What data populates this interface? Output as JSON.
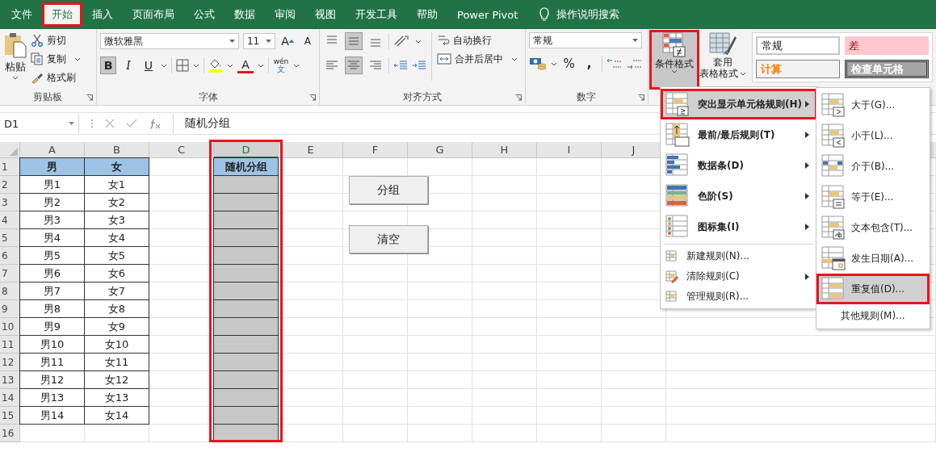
{
  "ribbon_tabs": [
    {
      "label": "文件",
      "selected": false,
      "highlighted": false
    },
    {
      "label": "开始",
      "selected": true,
      "highlighted": true
    },
    {
      "label": "插入",
      "selected": false,
      "highlighted": false
    },
    {
      "label": "页面布局",
      "selected": false,
      "highlighted": false
    },
    {
      "label": "公式",
      "selected": false,
      "highlighted": false
    },
    {
      "label": "数据",
      "selected": false,
      "highlighted": false
    },
    {
      "label": "审阅",
      "selected": false,
      "highlighted": false
    },
    {
      "label": "视图",
      "selected": false,
      "highlighted": false
    },
    {
      "label": "开发工具",
      "selected": false,
      "highlighted": false
    },
    {
      "label": "帮助",
      "selected": false,
      "highlighted": false
    },
    {
      "label": "Power Pivot",
      "selected": false,
      "highlighted": false
    }
  ],
  "tell_me": "操作说明搜索",
  "clipboard": {
    "paste": "粘贴",
    "cut": "剪切",
    "copy": "复制",
    "format_painter": "格式刷",
    "group": "剪贴板"
  },
  "font": {
    "name": "微软雅黑",
    "size": "11",
    "grow": "A",
    "shrink": "A",
    "bold": "B",
    "italic": "I",
    "underline": "U",
    "font_color": "A",
    "phonetic_top": "wén",
    "phonetic_bottom": "文",
    "group": "字体",
    "bold_on": true
  },
  "alignment": {
    "wrap": "自动换行",
    "merge": "合并后居中",
    "group": "对齐方式",
    "vertical": [
      {
        "kind": "top",
        "selected": false
      },
      {
        "kind": "middle",
        "selected": true
      },
      {
        "kind": "bottom",
        "selected": false
      }
    ],
    "horizontal": [
      {
        "kind": "left",
        "selected": false
      },
      {
        "kind": "center",
        "selected": true
      },
      {
        "kind": "right",
        "selected": false
      }
    ]
  },
  "number": {
    "format": "常规",
    "percent": "%",
    "comma": ",",
    "group": "数字"
  },
  "styles": {
    "conditional": {
      "label": "条件格式",
      "highlighted": true
    },
    "table": "套用",
    "table_2": "表格格式",
    "cell_styles": [
      {
        "label": "常规",
        "kind": "normal"
      },
      {
        "label": "差",
        "kind": "bad"
      },
      {
        "label": "计算",
        "kind": "calc"
      },
      {
        "label": "检查单元格",
        "kind": "check"
      }
    ]
  },
  "formula_bar": {
    "name_box": "D1",
    "value": "随机分组"
  },
  "sheet": {
    "columns": [
      {
        "label": "A",
        "selected": false,
        "highlighted": false
      },
      {
        "label": "B",
        "selected": false,
        "highlighted": false
      },
      {
        "label": "C",
        "selected": false,
        "highlighted": false
      },
      {
        "label": "D",
        "selected": true,
        "highlighted": true
      },
      {
        "label": "E",
        "selected": false,
        "highlighted": false
      },
      {
        "label": "F",
        "selected": false,
        "highlighted": false
      },
      {
        "label": "G",
        "selected": false,
        "highlighted": false
      },
      {
        "label": "H",
        "selected": false,
        "highlighted": false
      },
      {
        "label": "I",
        "selected": false,
        "highlighted": false
      },
      {
        "label": "J",
        "selected": false,
        "highlighted": false
      }
    ],
    "rows": [
      {
        "number": "1",
        "kind": "header",
        "cells": [
          "男",
          "女",
          "",
          "随机分组"
        ]
      },
      {
        "number": "2",
        "kind": "data",
        "cells": [
          "男1",
          "女1",
          "",
          ""
        ]
      },
      {
        "number": "3",
        "kind": "data",
        "cells": [
          "男2",
          "女2",
          "",
          ""
        ]
      },
      {
        "number": "4",
        "kind": "data",
        "cells": [
          "男3",
          "女3",
          "",
          ""
        ]
      },
      {
        "number": "5",
        "kind": "data",
        "cells": [
          "男4",
          "女4",
          "",
          ""
        ]
      },
      {
        "number": "6",
        "kind": "data",
        "cells": [
          "男5",
          "女5",
          "",
          ""
        ]
      },
      {
        "number": "7",
        "kind": "data",
        "cells": [
          "男6",
          "女6",
          "",
          ""
        ]
      },
      {
        "number": "8",
        "kind": "data",
        "cells": [
          "男7",
          "女7",
          "",
          ""
        ]
      },
      {
        "number": "9",
        "kind": "data",
        "cells": [
          "男8",
          "女8",
          "",
          ""
        ]
      },
      {
        "number": "10",
        "kind": "data",
        "cells": [
          "男9",
          "女9",
          "",
          ""
        ]
      },
      {
        "number": "11",
        "kind": "data",
        "cells": [
          "男10",
          "女10",
          "",
          ""
        ]
      },
      {
        "number": "12",
        "kind": "data",
        "cells": [
          "男11",
          "女11",
          "",
          ""
        ]
      },
      {
        "number": "13",
        "kind": "data",
        "cells": [
          "男12",
          "女12",
          "",
          ""
        ]
      },
      {
        "number": "14",
        "kind": "data",
        "cells": [
          "男13",
          "女13",
          "",
          ""
        ]
      },
      {
        "number": "15",
        "kind": "data",
        "cells": [
          "男14",
          "女14",
          "",
          ""
        ]
      },
      {
        "number": "16",
        "kind": "data",
        "cells": [
          "",
          "",
          "",
          ""
        ]
      }
    ]
  },
  "sheet_buttons": [
    "分组",
    "清空"
  ],
  "cf_menu": [
    {
      "label": "突出显示单元格规则(H)",
      "kind": "highlight",
      "submenu": true,
      "selected": true,
      "highlighted": true
    },
    {
      "label": "最前/最后规则(T)",
      "kind": "topbottom",
      "submenu": true,
      "selected": false,
      "highlighted": false
    },
    {
      "label": "数据条(D)",
      "kind": "databar",
      "submenu": true,
      "selected": false,
      "highlighted": false
    },
    {
      "label": "色阶(S)",
      "kind": "colorscale",
      "submenu": true,
      "selected": false,
      "highlighted": false
    },
    {
      "label": "图标集(I)",
      "kind": "iconset",
      "submenu": true,
      "selected": false,
      "highlighted": false
    },
    {
      "label": "新建规则(N)...",
      "kind": "new",
      "submenu": false,
      "selected": false,
      "highlighted": false
    },
    {
      "label": "清除规则(C)",
      "kind": "clear",
      "submenu": true,
      "selected": false,
      "highlighted": false
    },
    {
      "label": "管理规则(R)...",
      "kind": "manage",
      "submenu": false,
      "selected": false,
      "highlighted": false
    }
  ],
  "cf_submenu": [
    {
      "label": "大于(G)...",
      "kind": "gt",
      "selected": false,
      "highlighted": false
    },
    {
      "label": "小于(L)...",
      "kind": "lt",
      "selected": false,
      "highlighted": false
    },
    {
      "label": "介于(B)...",
      "kind": "between",
      "selected": false,
      "highlighted": false
    },
    {
      "label": "等于(E)...",
      "kind": "eq",
      "selected": false,
      "highlighted": false
    },
    {
      "label": "文本包含(T)...",
      "kind": "text",
      "selected": false,
      "highlighted": false
    },
    {
      "label": "发生日期(A)...",
      "kind": "date",
      "selected": false,
      "highlighted": false
    },
    {
      "label": "重复值(D)...",
      "kind": "dup",
      "selected": true,
      "highlighted": true
    },
    {
      "label": "其他规则(M)...",
      "kind": "more",
      "selected": false,
      "highlighted": false
    }
  ]
}
